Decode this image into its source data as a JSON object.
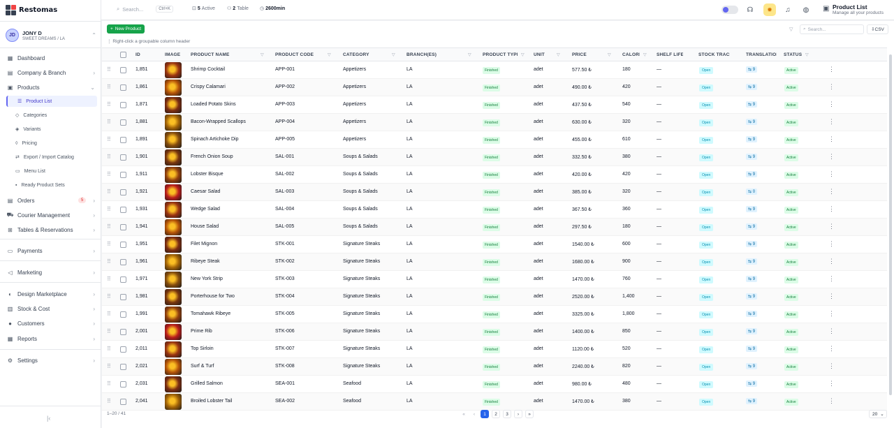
{
  "app": {
    "name": "Restomas"
  },
  "user": {
    "initials": "JD",
    "name": "JONY D",
    "branch": "SWEET DREAMS / LA"
  },
  "nav": {
    "dashboard": "Dashboard",
    "company": "Company & Branch",
    "products": "Products",
    "product_list": "Product List",
    "categories": "Categories",
    "variants": "Variants",
    "pricing": "Pricing",
    "export_import": "Export / Import Catalog",
    "menu_list": "Menu List",
    "ready_sets": "Ready Product Sets",
    "orders": "Orders",
    "orders_badge": "5",
    "courier": "Courier Management",
    "tables": "Tables & Reservations",
    "payments": "Payments",
    "marketing": "Marketing",
    "design": "Design Marketplace",
    "stock": "Stock & Cost",
    "customers": "Customers",
    "reports": "Reports",
    "settings": "Settings"
  },
  "topbar": {
    "search_placeholder": "Search...",
    "search_shortcut": "Ctrl+K",
    "active_count": "5",
    "active_label": "Active",
    "table_count": "2",
    "table_label": "Table",
    "timer": "2600min",
    "page_title": "Product List",
    "page_subtitle": "Manage all your products"
  },
  "toolbar": {
    "new_product": "New Product",
    "hint": "Right-click a groupable column header",
    "search_placeholder": "Search...",
    "csv": "CSV"
  },
  "columns": {
    "id": "ID",
    "image": "IMAGE",
    "name": "PRODUCT NAME",
    "code": "PRODUCT CODE",
    "category": "CATEGORY",
    "branch": "BRANCH(ES)",
    "type": "PRODUCT TYPE",
    "unit": "UNIT",
    "price": "PRICE",
    "calories": "CALORIES",
    "shelf": "SHELF LIFE",
    "stock": "STOCK TRACKING",
    "translation": "TRANSLATIONS",
    "status": "STATUS"
  },
  "rows": [
    {
      "id": "1,851",
      "name": "Shrimp Cocktail",
      "code": "APP-001",
      "category": "Appetizers",
      "branch": "LA",
      "type": "Finished",
      "unit": "adet",
      "price": "577.50 ₺",
      "cal": "180",
      "shelf": "—",
      "stock": "Open",
      "trans": "9",
      "status": "Active"
    },
    {
      "id": "1,861",
      "name": "Crispy Calamari",
      "code": "APP-002",
      "category": "Appetizers",
      "branch": "LA",
      "type": "Finished",
      "unit": "adet",
      "price": "490.00 ₺",
      "cal": "420",
      "shelf": "—",
      "stock": "Open",
      "trans": "9",
      "status": "Active"
    },
    {
      "id": "1,871",
      "name": "Loaded Potato Skins",
      "code": "APP-003",
      "category": "Appetizers",
      "branch": "LA",
      "type": "Finished",
      "unit": "adet",
      "price": "437.50 ₺",
      "cal": "540",
      "shelf": "—",
      "stock": "Open",
      "trans": "9",
      "status": "Active"
    },
    {
      "id": "1,881",
      "name": "Bacon-Wrapped Scallops",
      "code": "APP-004",
      "category": "Appetizers",
      "branch": "LA",
      "type": "Finished",
      "unit": "adet",
      "price": "630.00 ₺",
      "cal": "320",
      "shelf": "—",
      "stock": "Open",
      "trans": "9",
      "status": "Active"
    },
    {
      "id": "1,891",
      "name": "Spinach Artichoke Dip",
      "code": "APP-005",
      "category": "Appetizers",
      "branch": "LA",
      "type": "Finished",
      "unit": "adet",
      "price": "455.00 ₺",
      "cal": "610",
      "shelf": "—",
      "stock": "Open",
      "trans": "9",
      "status": "Active"
    },
    {
      "id": "1,901",
      "name": "French Onion Soup",
      "code": "SAL-001",
      "category": "Soups & Salads",
      "branch": "LA",
      "type": "Finished",
      "unit": "adet",
      "price": "332.50 ₺",
      "cal": "380",
      "shelf": "—",
      "stock": "Open",
      "trans": "9",
      "status": "Active"
    },
    {
      "id": "1,911",
      "name": "Lobster Bisque",
      "code": "SAL-002",
      "category": "Soups & Salads",
      "branch": "LA",
      "type": "Finished",
      "unit": "adet",
      "price": "420.00 ₺",
      "cal": "420",
      "shelf": "—",
      "stock": "Open",
      "trans": "9",
      "status": "Active"
    },
    {
      "id": "1,921",
      "name": "Caesar Salad",
      "code": "SAL-003",
      "category": "Soups & Salads",
      "branch": "LA",
      "type": "Finished",
      "unit": "adet",
      "price": "385.00 ₺",
      "cal": "320",
      "shelf": "—",
      "stock": "Open",
      "trans": "0",
      "status": "Active"
    },
    {
      "id": "1,931",
      "name": "Wedge Salad",
      "code": "SAL-004",
      "category": "Soups & Salads",
      "branch": "LA",
      "type": "Finished",
      "unit": "adet",
      "price": "367.50 ₺",
      "cal": "360",
      "shelf": "—",
      "stock": "Open",
      "trans": "9",
      "status": "Active"
    },
    {
      "id": "1,941",
      "name": "House Salad",
      "code": "SAL-005",
      "category": "Soups & Salads",
      "branch": "LA",
      "type": "Finished",
      "unit": "adet",
      "price": "297.50 ₺",
      "cal": "180",
      "shelf": "—",
      "stock": "Open",
      "trans": "9",
      "status": "Active"
    },
    {
      "id": "1,951",
      "name": "Filet Mignon",
      "code": "STK-001",
      "category": "Signature Steaks",
      "branch": "LA",
      "type": "Finished",
      "unit": "adet",
      "price": "1540.00 ₺",
      "cal": "600",
      "shelf": "—",
      "stock": "Open",
      "trans": "9",
      "status": "Active"
    },
    {
      "id": "1,961",
      "name": "Ribeye Steak",
      "code": "STK-002",
      "category": "Signature Steaks",
      "branch": "LA",
      "type": "Finished",
      "unit": "adet",
      "price": "1680.00 ₺",
      "cal": "900",
      "shelf": "—",
      "stock": "Open",
      "trans": "9",
      "status": "Active"
    },
    {
      "id": "1,971",
      "name": "New York Strip",
      "code": "STK-003",
      "category": "Signature Steaks",
      "branch": "LA",
      "type": "Finished",
      "unit": "adet",
      "price": "1470.00 ₺",
      "cal": "760",
      "shelf": "—",
      "stock": "Open",
      "trans": "9",
      "status": "Active"
    },
    {
      "id": "1,981",
      "name": "Porterhouse for Two",
      "code": "STK-004",
      "category": "Signature Steaks",
      "branch": "LA",
      "type": "Finished",
      "unit": "adet",
      "price": "2520.00 ₺",
      "cal": "1,400",
      "shelf": "—",
      "stock": "Open",
      "trans": "9",
      "status": "Active"
    },
    {
      "id": "1,991",
      "name": "Tomahawk Ribeye",
      "code": "STK-005",
      "category": "Signature Steaks",
      "branch": "LA",
      "type": "Finished",
      "unit": "adet",
      "price": "3325.00 ₺",
      "cal": "1,800",
      "shelf": "—",
      "stock": "Open",
      "trans": "9",
      "status": "Active"
    },
    {
      "id": "2,001",
      "name": "Prime Rib",
      "code": "STK-006",
      "category": "Signature Steaks",
      "branch": "LA",
      "type": "Finished",
      "unit": "adet",
      "price": "1400.00 ₺",
      "cal": "850",
      "shelf": "—",
      "stock": "Open",
      "trans": "9",
      "status": "Active"
    },
    {
      "id": "2,011",
      "name": "Top Sirloin",
      "code": "STK-007",
      "category": "Signature Steaks",
      "branch": "LA",
      "type": "Finished",
      "unit": "adet",
      "price": "1120.00 ₺",
      "cal": "520",
      "shelf": "—",
      "stock": "Open",
      "trans": "9",
      "status": "Active"
    },
    {
      "id": "2,021",
      "name": "Surf & Turf",
      "code": "STK-008",
      "category": "Signature Steaks",
      "branch": "LA",
      "type": "Finished",
      "unit": "adet",
      "price": "2240.00 ₺",
      "cal": "820",
      "shelf": "—",
      "stock": "Open",
      "trans": "9",
      "status": "Active"
    },
    {
      "id": "2,031",
      "name": "Grilled Salmon",
      "code": "SEA-001",
      "category": "Seafood",
      "branch": "LA",
      "type": "Finished",
      "unit": "adet",
      "price": "980.00 ₺",
      "cal": "480",
      "shelf": "—",
      "stock": "Open",
      "trans": "9",
      "status": "Active"
    },
    {
      "id": "2,041",
      "name": "Broiled Lobster Tail",
      "code": "SEA-002",
      "category": "Seafood",
      "branch": "LA",
      "type": "Finished",
      "unit": "adet",
      "price": "1470.00 ₺",
      "cal": "380",
      "shelf": "—",
      "stock": "Open",
      "trans": "9",
      "status": "Active"
    }
  ],
  "footer": {
    "count": "1–20 / 41",
    "pages": [
      "1",
      "2",
      "3"
    ],
    "page_size": "20"
  },
  "colors": {
    "accent": "#16a34a",
    "primary": "#2563eb"
  }
}
